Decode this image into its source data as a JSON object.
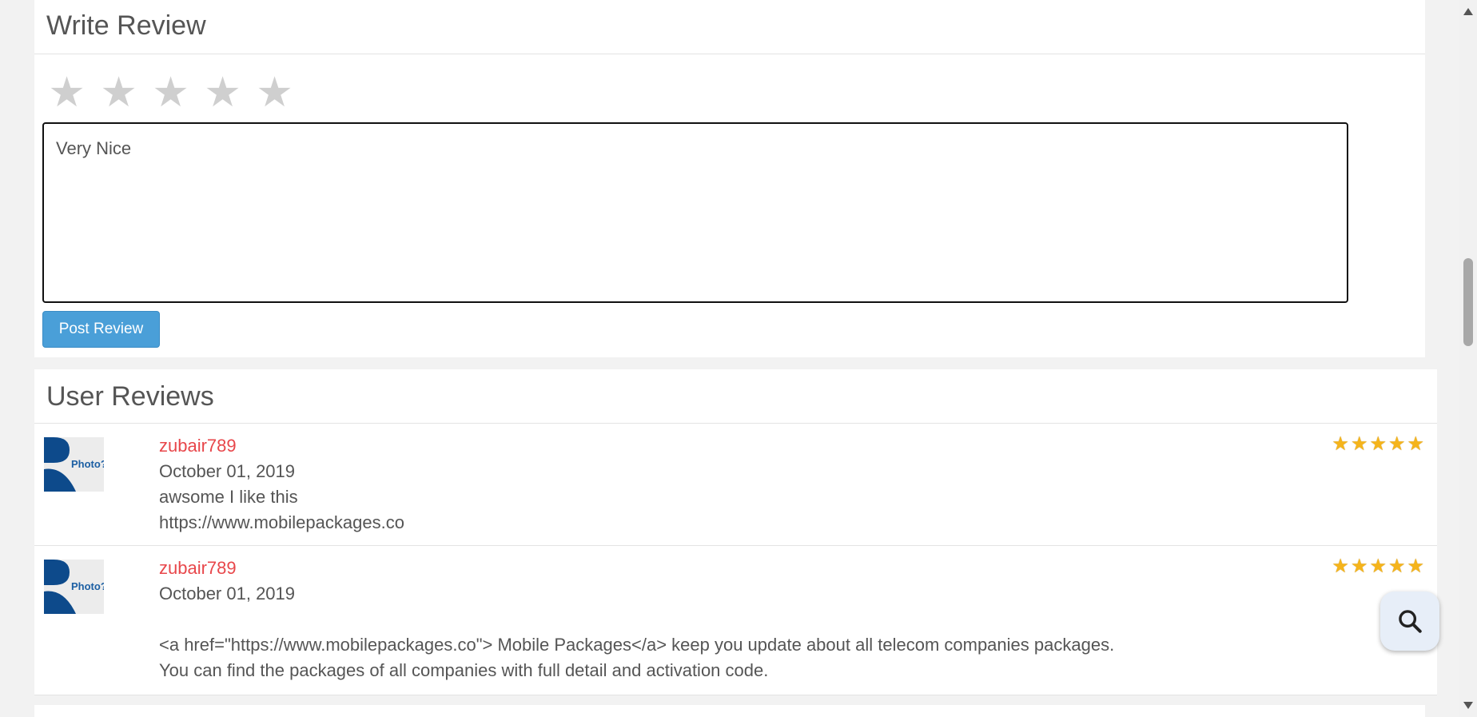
{
  "write_review": {
    "title": "Write Review",
    "star_glyph": "★",
    "stars_count": 5,
    "textarea_value": "Very Nice",
    "post_label": "Post Review"
  },
  "user_reviews": {
    "title": "User Reviews",
    "items": [
      {
        "user": "zubair789",
        "date": "October 01, 2019",
        "text_lines": [
          "awsome I like this",
          "https://www.mobilepackages.co"
        ],
        "rating": 5,
        "avatar_text": "Photo?"
      },
      {
        "user": "zubair789",
        "date": "October 01, 2019",
        "text_lines": [
          "",
          "<a href=\"https://www.mobilepackages.co\"> Mobile Packages</a> keep you update about all telecom companies packages.",
          "You can find the packages of all companies with full detail and activation code."
        ],
        "rating": 5,
        "avatar_text": "Photo?"
      }
    ]
  },
  "colors": {
    "accent_button": "#4a9fd8",
    "username": "#e8474b",
    "rating_star": "#f5b41b",
    "empty_star": "#cfcfcf"
  },
  "icons": {
    "fab": "search-icon"
  }
}
